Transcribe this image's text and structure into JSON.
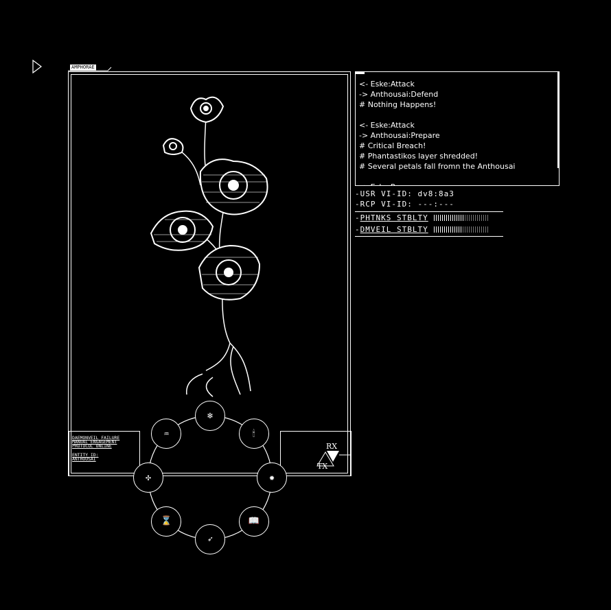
{
  "panel_tab_label": "AMPHORAE",
  "status": {
    "line1": "DAEMONVEIL FAILURE",
    "line2": "MANUAL ENGAGEMENT",
    "line3": "PROTOCOL ONLINE",
    "line4": "ENTITY ID:",
    "line5": "ANTHOUSAI"
  },
  "rxtx": {
    "rx": "RX",
    "tx": "TX"
  },
  "log": [
    "<- Eske:Attack",
    "-> Anthousai:Defend",
    "# Nothing Happens!",
    "",
    "<- Eske:Attack",
    "-> Anthousai:Prepare",
    "# Critical Breach!",
    "# Phantastikos layer shredded!",
    "# Several petals fall fromn the Anthousai",
    "",
    "<- Eske:Prepare"
  ],
  "ids": {
    "usr_label": "USR VI-ID:",
    "usr_value": "dv8:8a3",
    "rcp_label": "RCP VI-ID:",
    "rcp_value": "---:---"
  },
  "bars": [
    {
      "label": "PHTNKS STBLTY",
      "level": 0.55
    },
    {
      "label": "DMVEIL STBLTY",
      "level": 0.5
    }
  ],
  "wheel": [
    {
      "icon": "snowflake-icon",
      "glyph": "❄"
    },
    {
      "icon": "candle-icon",
      "glyph": "🕯"
    },
    {
      "icon": "gear-icon",
      "glyph": "✹"
    },
    {
      "icon": "book-icon",
      "glyph": "📖"
    },
    {
      "icon": "arrow-icon",
      "glyph": "➶"
    },
    {
      "icon": "hourglass-icon",
      "glyph": "⌛"
    },
    {
      "icon": "compass-icon",
      "glyph": "✣"
    },
    {
      "icon": "aquarius-icon",
      "glyph": "♒"
    }
  ]
}
